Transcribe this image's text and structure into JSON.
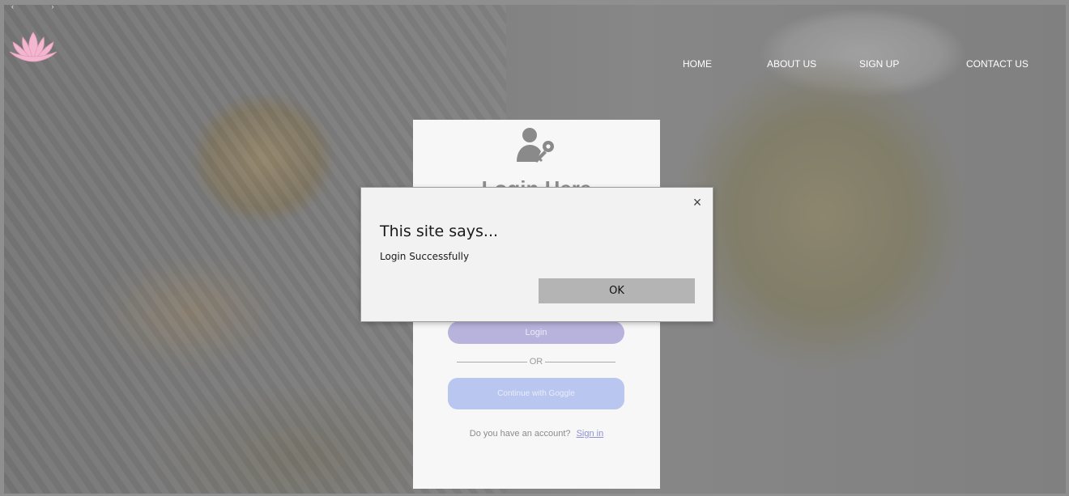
{
  "window": {
    "arrows": "‹   ›"
  },
  "nav": {
    "items": [
      {
        "label": "HOME"
      },
      {
        "label": "ABOUT US"
      },
      {
        "label": "SIGN UP"
      },
      {
        "label": "CONTACT US"
      }
    ]
  },
  "login_card": {
    "title": "Login Here",
    "login_button": "Login",
    "or_divider": "OR",
    "google_button": "Continue with Goggle",
    "account_prompt": "Do you have an account?",
    "signin_link": "Sign in"
  },
  "dialog": {
    "close": "×",
    "title": "This site says...",
    "message": "Login Successfully",
    "ok_label": "OK"
  },
  "colors": {
    "login_button": "#b7b3dc",
    "google_button": "#b9c6ef",
    "signin_link": "#8e8ed6",
    "logo": "#f2b6cf"
  },
  "icons": {
    "logo": "lotus-icon",
    "user": "user-key-icon"
  }
}
